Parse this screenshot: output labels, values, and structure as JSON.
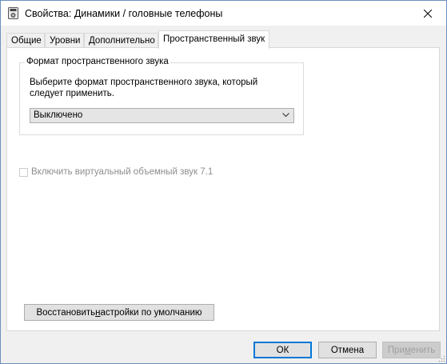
{
  "window": {
    "title": "Свойства: Динамики / головные телефоны"
  },
  "tabs": [
    {
      "label": "Общие",
      "active": false
    },
    {
      "label": "Уровни",
      "active": false
    },
    {
      "label": "Дополнительно",
      "active": false
    },
    {
      "label": "Пространственный звук",
      "active": true
    }
  ],
  "spatial": {
    "group_label": "Формат пространственного звука",
    "description": "Выберите формат пространственного звука, который следует применить.",
    "format_selected": "Выключено",
    "virtual_surround_label": "Включить виртуальный объемный звук 7.1",
    "virtual_surround_checked": false,
    "virtual_surround_enabled": false
  },
  "restore_button": {
    "before": "Восстановить ",
    "accel": "н",
    "after": "астройки по умолчанию"
  },
  "footer": {
    "ok_label": "ОК",
    "cancel_label": "Отмена",
    "apply_before": "При",
    "apply_accel": "м",
    "apply_after": "енить"
  },
  "colors": {
    "accent": "#0078d7",
    "disabled_text": "#8d8d8d"
  },
  "icons": {
    "app": "speaker-icon",
    "close": "close-icon",
    "dropdown": "chevron-down-icon"
  }
}
